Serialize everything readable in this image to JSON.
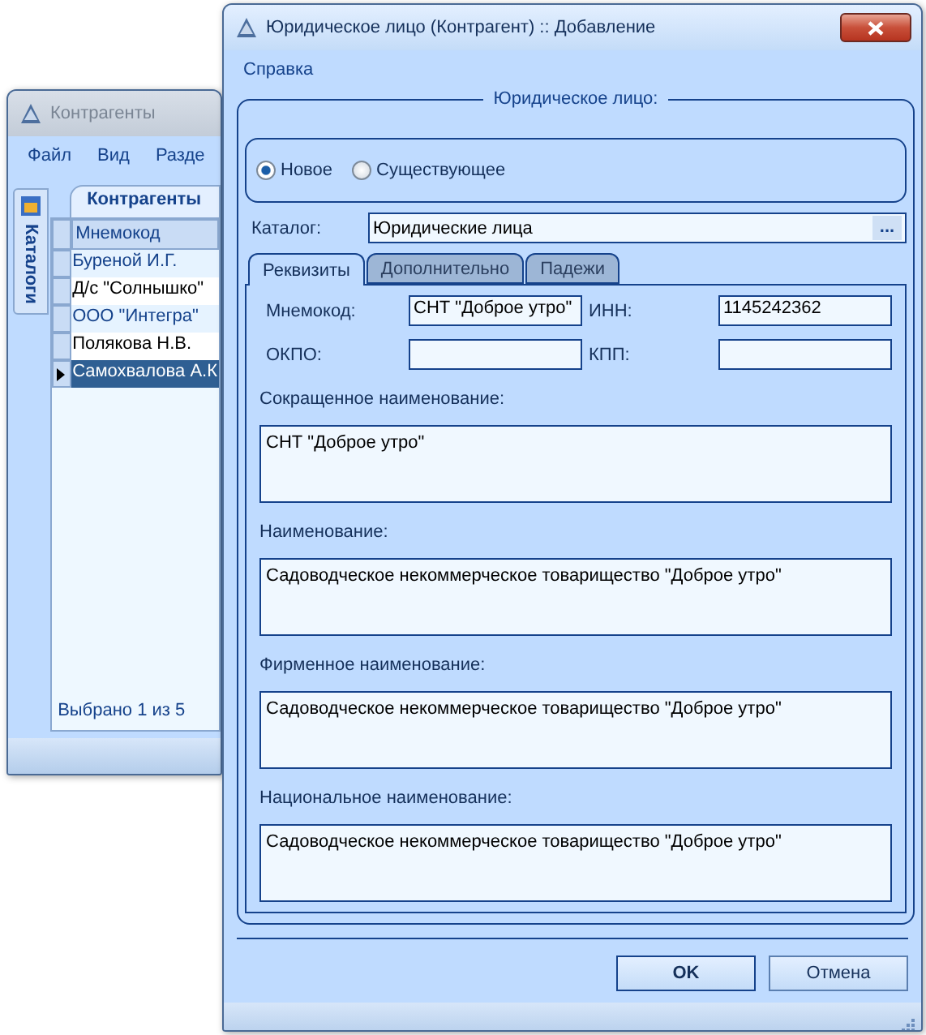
{
  "back_window": {
    "title": "Контрагенты",
    "menu": [
      "Файл",
      "Вид",
      "Разде"
    ],
    "side_tab": "Каталоги",
    "tab": "Контрагенты",
    "column": "Мнемокод",
    "rows": [
      {
        "text": "Буреной И.Г.",
        "selected": false
      },
      {
        "text": "Д/с \"Солнышко\"",
        "selected": false
      },
      {
        "text": "ООО \"Интегра\"",
        "selected": false
      },
      {
        "text": "Полякова Н.В.",
        "selected": false
      },
      {
        "text": "Самохвалова А.К",
        "selected": true
      }
    ],
    "status": "Выбрано 1 из 5"
  },
  "dialog": {
    "title": "Юридическое лицо (Контрагент) :: Добавление",
    "menu": [
      "Справка"
    ],
    "group_title": "Юридическое лицо:",
    "radios": [
      {
        "label": "Новое",
        "selected": true
      },
      {
        "label": "Существующее",
        "selected": false
      }
    ],
    "catalog": {
      "label": "Каталог:",
      "value": "Юридические лица",
      "button": "..."
    },
    "tabs": [
      {
        "label": "Реквизиты",
        "selected": true
      },
      {
        "label": "Дополнительно",
        "selected": false
      },
      {
        "label": "Падежи",
        "selected": false
      }
    ],
    "fields": [
      {
        "label": "Мнемокод:",
        "value": "СНТ \"Доброе утро\""
      },
      {
        "label": "ИНН:",
        "value": "1145242362"
      },
      {
        "label": "ОКПО:"
      },
      {
        "label": "КПП:"
      }
    ],
    "memos": [
      {
        "label": "Сокращенное наименование:",
        "value": "СНТ \"Доброе утро\""
      },
      {
        "label": "Наименование:",
        "value": "Садоводческое некоммерческое товарищество \"Доброе утро\""
      },
      {
        "label": "Фирменное наименование:",
        "value": "Садоводческое некоммерческое товарищество \"Доброе утро\""
      },
      {
        "label": "Национальное наименование:",
        "value": "Садоводческое некоммерческое товарищество \"Доброе утро\""
      }
    ],
    "buttons": [
      {
        "label": "OK",
        "kind": "primary"
      },
      {
        "label": "Отмена",
        "kind": "normal"
      }
    ]
  }
}
